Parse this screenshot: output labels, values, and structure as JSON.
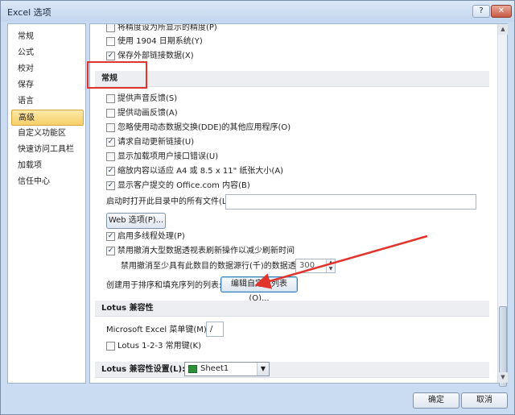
{
  "window": {
    "title": "Excel 选项"
  },
  "titlebar": {
    "help_label": "?",
    "close_label": "✕"
  },
  "sidebar": {
    "items": [
      {
        "label": "常规"
      },
      {
        "label": "公式"
      },
      {
        "label": "校对"
      },
      {
        "label": "保存"
      },
      {
        "label": "语言"
      },
      {
        "label": "高级",
        "selected": true
      },
      {
        "label": "自定义功能区"
      },
      {
        "label": "快速访问工具栏"
      },
      {
        "label": "加载项"
      },
      {
        "label": "信任中心"
      }
    ]
  },
  "content": {
    "top_options": [
      {
        "label": "将精度设为所显示的精度(P)",
        "checked": false
      },
      {
        "label": "使用 1904 日期系统(Y)",
        "checked": false
      },
      {
        "label": "保存外部链接数据(X)",
        "checked": true
      }
    ],
    "general_header": "常规",
    "general_options": [
      {
        "label": "提供声音反馈(S)",
        "checked": false
      },
      {
        "label": "提供动画反馈(A)",
        "checked": false
      },
      {
        "label": "忽略使用动态数据交换(DDE)的其他应用程序(O)",
        "checked": false
      },
      {
        "label": "请求自动更新链接(U)",
        "checked": true
      },
      {
        "label": "显示加载项用户接口错误(U)",
        "checked": false
      },
      {
        "label": "缩放内容以适应 A4 或 8.5 x 11\" 纸张大小(A)",
        "checked": true
      },
      {
        "label": "显示客户提交的 Office.com 内容(B)",
        "checked": true
      }
    ],
    "startup_label": "启动时打开此目录中的所有文件(L):",
    "startup_value": "",
    "web_options_button": "Web 选项(P)...",
    "multithread": {
      "label": "启用多线程处理(P)",
      "checked": true
    },
    "pivot_cancel": {
      "label": "禁用撤消大型数据透视表刷新操作以减少刷新时间",
      "checked": true
    },
    "pivot_rows": {
      "label": "禁用撤消至少具有此数目的数据源行(千)的数据透视表:",
      "value": "300",
      "up": "▲",
      "down": "▼"
    },
    "custom_lists_label": "创建用于排序和填充序列的列表:",
    "custom_lists_button": "编辑自定义列表(O)...",
    "lotus_header": "Lotus 兼容性",
    "menu_key_label": "Microsoft Excel 菜单键(M):",
    "menu_key_value": "/",
    "lotus_nav": {
      "label": "Lotus 1-2-3 常用键(K)",
      "checked": false
    },
    "lotus_settings_label": "Lotus 兼容性设置(L):",
    "lotus_settings_value": "Sheet1",
    "combo_arrow": "▼"
  },
  "scrollbar": {
    "up": "▲",
    "down": "▼"
  },
  "footer": {
    "ok_label": "确定",
    "cancel_label": "取消"
  },
  "colors": {
    "selection": "#f6cf6a",
    "highlight_box": "#e0342c",
    "arrow": "#e0342c"
  }
}
